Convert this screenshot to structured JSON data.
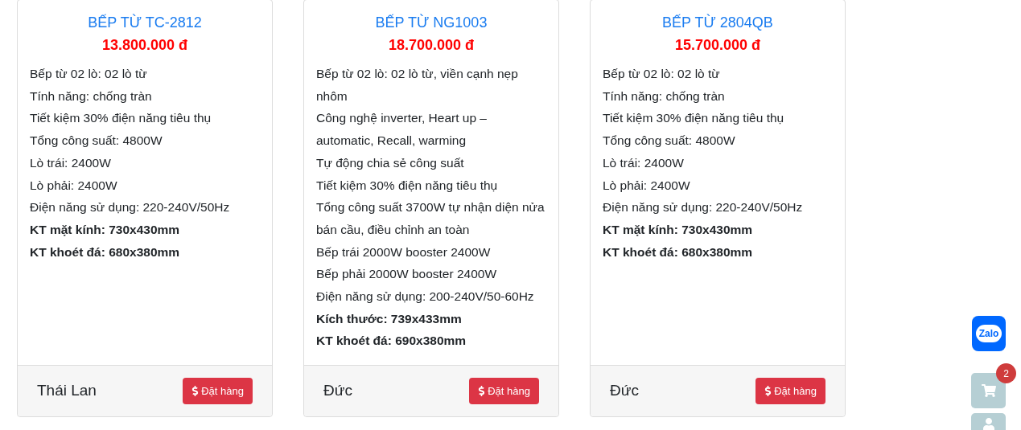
{
  "products": [
    {
      "title": "BẾP TỪ TC-2812",
      "price": "13.800.000 đ",
      "specs": [
        {
          "text": "Bếp từ 02 lò: 02 lò từ",
          "bold": false
        },
        {
          "text": "Tính năng: chống tràn",
          "bold": false
        },
        {
          "text": "Tiết kiệm 30% điện năng tiêu thụ",
          "bold": false
        },
        {
          "text": "Tổng công suất: 4800W",
          "bold": false
        },
        {
          "text": "Lò trái: 2400W",
          "bold": false
        },
        {
          "text": "Lò phải: 2400W",
          "bold": false
        },
        {
          "text": "Điện năng sử dụng: 220-240V/50Hz",
          "bold": false
        },
        {
          "text": "KT mặt kính: 730x430mm",
          "bold": true
        },
        {
          "text": "KT khoét đá: 680x380mm",
          "bold": true
        }
      ],
      "origin": "Thái Lan",
      "button": "Đặt hàng"
    },
    {
      "title": "BẾP TỪ NG1003",
      "price": "18.700.000 đ",
      "specs": [
        {
          "text": "Bếp từ 02 lò: 02 lò từ, viền cạnh nẹp nhôm",
          "bold": false
        },
        {
          "text": "Công nghệ inverter, Heart up – automatic, Recall, warming",
          "bold": false
        },
        {
          "text": "Tự động chia sẻ công suất",
          "bold": false
        },
        {
          "text": "Tiết kiệm 30% điện năng tiêu thụ",
          "bold": false
        },
        {
          "text": "Tổng công suất 3700W tự nhận diện nửa bán cầu, điều chỉnh an toàn",
          "bold": false
        },
        {
          "text": "Bếp trái 2000W booster 2400W",
          "bold": false
        },
        {
          "text": "Bếp phải 2000W booster 2400W",
          "bold": false
        },
        {
          "text": "Điện năng sử dụng: 200-240V/50-60Hz",
          "bold": false
        },
        {
          "text": "Kích thước: 739x433mm",
          "bold": true
        },
        {
          "text": "KT khoét đá: 690x380mm",
          "bold": true
        }
      ],
      "origin": "Đức",
      "button": "Đặt hàng"
    },
    {
      "title": "BẾP TỪ 2804QB",
      "price": "15.700.000 đ",
      "specs": [
        {
          "text": "Bếp từ 02 lò: 02 lò từ",
          "bold": false
        },
        {
          "text": "Tính năng: chống tràn",
          "bold": false
        },
        {
          "text": "Tiết kiệm 30% điện năng tiêu thụ",
          "bold": false
        },
        {
          "text": "Tổng công suất: 4800W",
          "bold": false
        },
        {
          "text": "Lò trái: 2400W",
          "bold": false
        },
        {
          "text": "Lò phải: 2400W",
          "bold": false
        },
        {
          "text": "Điện năng sử dụng: 220-240V/50Hz",
          "bold": false
        },
        {
          "text": "KT mặt kính: 730x430mm",
          "bold": true
        },
        {
          "text": "KT khoét đá: 680x380mm",
          "bold": true
        }
      ],
      "origin": "Đức",
      "button": "Đặt hàng"
    }
  ],
  "zalo": "Zalo",
  "cart_badge": "2"
}
